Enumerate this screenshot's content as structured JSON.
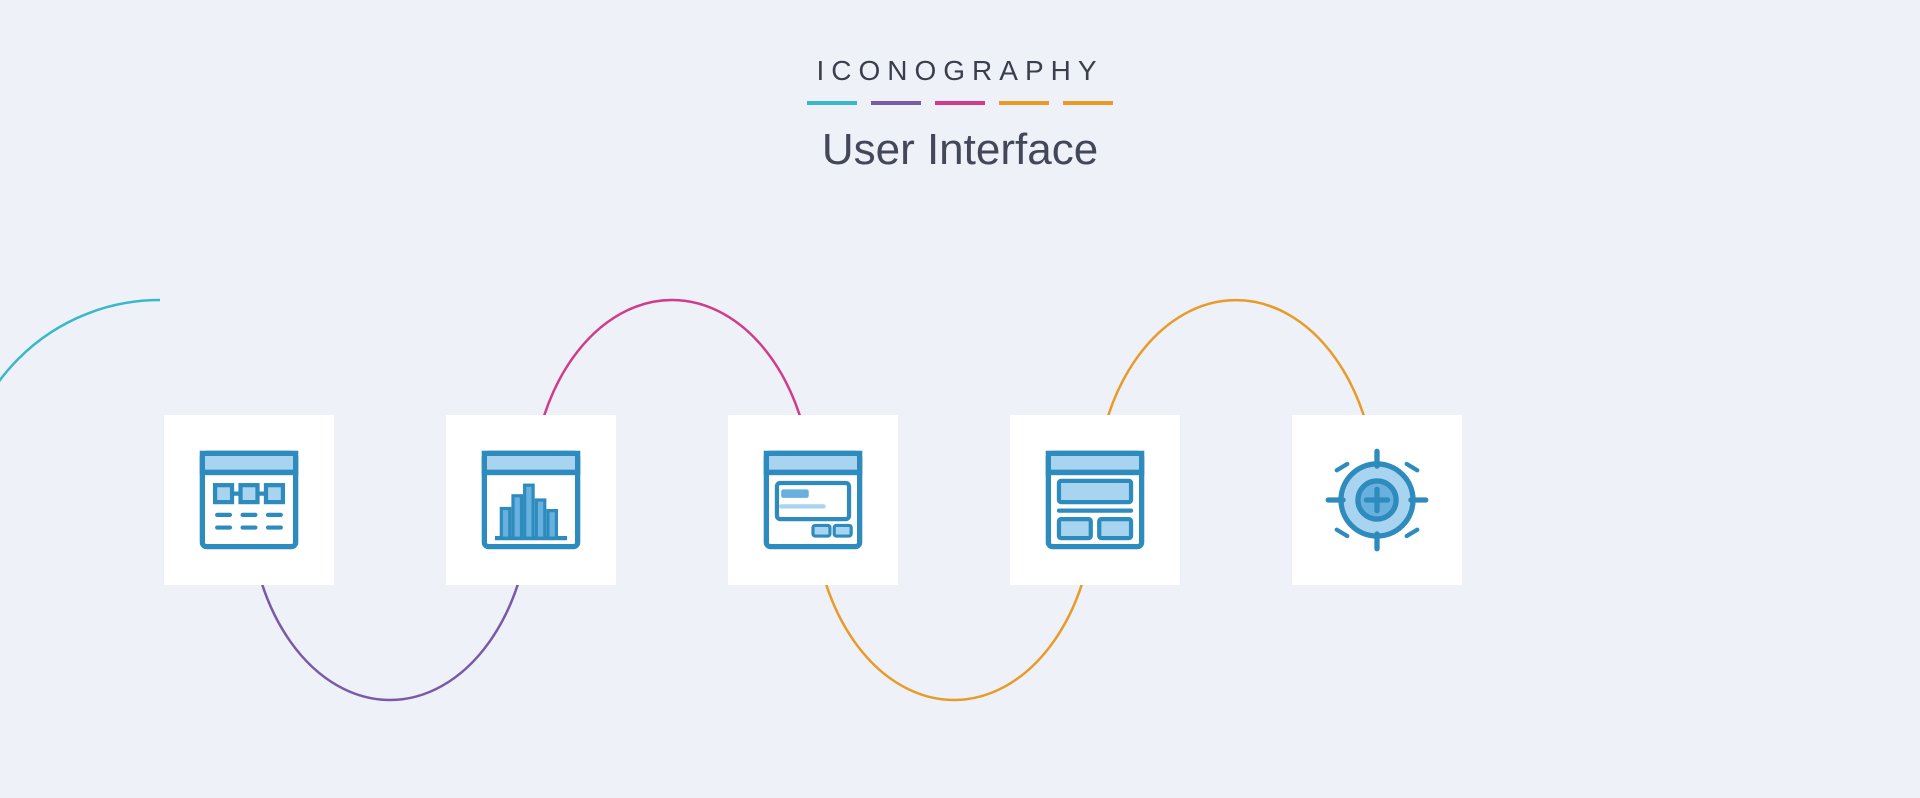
{
  "header": {
    "brand": "ICONOGRAPHY",
    "subtitle": "User Interface"
  },
  "underline_colors": [
    "#39b8c9",
    "#7a5aa8",
    "#d13c8a",
    "#e99a27",
    "#e99a27"
  ],
  "wave": {
    "arc_colors": [
      "#39b8c9",
      "#7a5aa8",
      "#d13c8a",
      "#e99a27",
      "#e99a27"
    ]
  },
  "icons": [
    {
      "name": "sitemap-window-icon"
    },
    {
      "name": "bar-chart-window-icon"
    },
    {
      "name": "form-window-icon"
    },
    {
      "name": "layout-window-icon"
    },
    {
      "name": "target-crosshair-icon"
    }
  ],
  "palette": {
    "icon_stroke": "#2e8bbd",
    "icon_fill_light": "#a9d4ef",
    "icon_fill_mid": "#68b0de",
    "bg": "#eef1f7",
    "card": "#ffffff"
  }
}
